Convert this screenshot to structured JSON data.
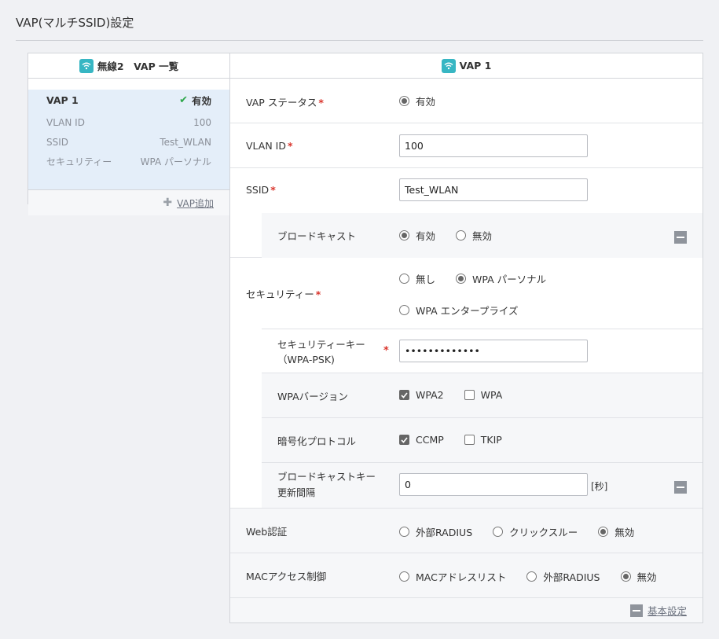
{
  "page": {
    "title": "VAP(マルチSSID)設定"
  },
  "left": {
    "header": "無線2　VAP 一覧",
    "vap": {
      "name": "VAP 1",
      "status": "有効",
      "rows": [
        {
          "label": "VLAN ID",
          "value": "100"
        },
        {
          "label": "SSID",
          "value": "Test_WLAN"
        },
        {
          "label": "セキュリティー",
          "value": "WPA パーソナル"
        }
      ]
    },
    "add_label": "VAP追加"
  },
  "right": {
    "header": "VAP 1",
    "vap_status": {
      "label": "VAP ステータス",
      "option": "有効"
    },
    "vlan": {
      "label": "VLAN ID",
      "value": "100"
    },
    "ssid": {
      "label": "SSID",
      "value": "Test_WLAN"
    },
    "broadcast": {
      "label": "ブロードキャスト",
      "options": [
        "有効",
        "無効"
      ],
      "selected": "有効"
    },
    "security": {
      "label": "セキュリティー",
      "options": [
        "無し",
        "WPA パーソナル",
        "WPA エンタープライズ"
      ],
      "selected": "WPA パーソナル"
    },
    "psk": {
      "label_line1": "セキュリティーキー",
      "label_line2": "（WPA-PSK)",
      "value": "•••••••••••••"
    },
    "wpa_version": {
      "label": "WPAバージョン",
      "options": [
        "WPA2",
        "WPA"
      ],
      "checked": [
        "WPA2"
      ]
    },
    "cipher": {
      "label": "暗号化プロトコル",
      "options": [
        "CCMP",
        "TKIP"
      ],
      "checked": [
        "CCMP"
      ]
    },
    "rekey": {
      "label_line1": "ブロードキャストキー",
      "label_line2": "更新間隔",
      "value": "0",
      "unit": "[秒]"
    },
    "web_auth": {
      "label": "Web認証",
      "options": [
        "外部RADIUS",
        "クリックスルー",
        "無効"
      ],
      "selected": "無効"
    },
    "mac_ctrl": {
      "label": "MACアクセス制御",
      "options": [
        "MACアドレスリスト",
        "外部RADIUS",
        "無効"
      ],
      "selected": "無効"
    },
    "footer_link": "基本設定"
  },
  "colors": {
    "accent": "#37b6c3",
    "required": "#d9342b",
    "ok": "#2ca64a",
    "selected_card": "#e4eef9"
  }
}
